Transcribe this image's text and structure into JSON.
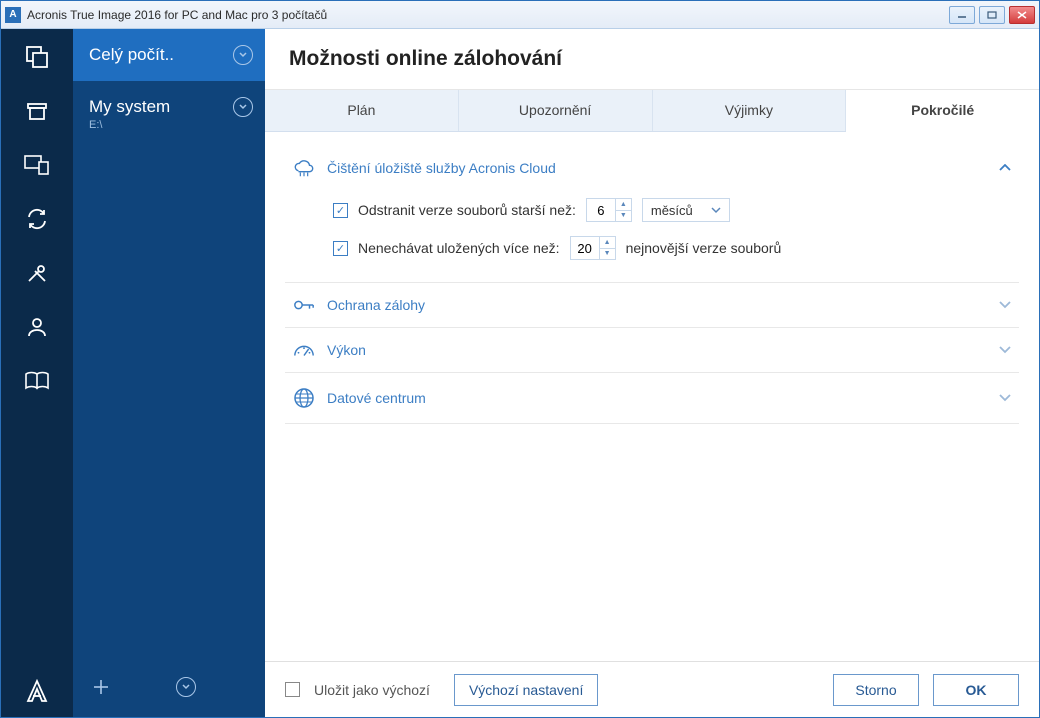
{
  "window": {
    "title": "Acronis True Image 2016 for PC and Mac pro 3 počítačů",
    "app_icon_letter": "A"
  },
  "sidebar": {
    "tasks": [
      {
        "label": "Celý počít.."
      },
      {
        "label": "My system",
        "subtitle": "E:\\"
      }
    ]
  },
  "header": {
    "title": "Možnosti online zálohování"
  },
  "tabs": {
    "items": [
      "Plán",
      "Upozornění",
      "Výjimky",
      "Pokročilé"
    ],
    "active_index": 3
  },
  "sections": {
    "cleanup": {
      "label": "Čištění úložiště služby Acronis Cloud",
      "opt1_label": "Odstranit verze souborů starší než:",
      "opt1_value": "6",
      "opt1_unit": "měsíců",
      "opt2_label": "Nenechávat uložených více než:",
      "opt2_value": "20",
      "opt2_suffix": "nejnovější verze souborů"
    },
    "protection": {
      "label": "Ochrana zálohy"
    },
    "performance": {
      "label": "Výkon"
    },
    "datacenter": {
      "label": "Datové centrum"
    }
  },
  "footer": {
    "save_default_label": "Uložit jako výchozí",
    "reset_label": "Výchozí nastavení",
    "cancel_label": "Storno",
    "ok_label": "OK"
  }
}
